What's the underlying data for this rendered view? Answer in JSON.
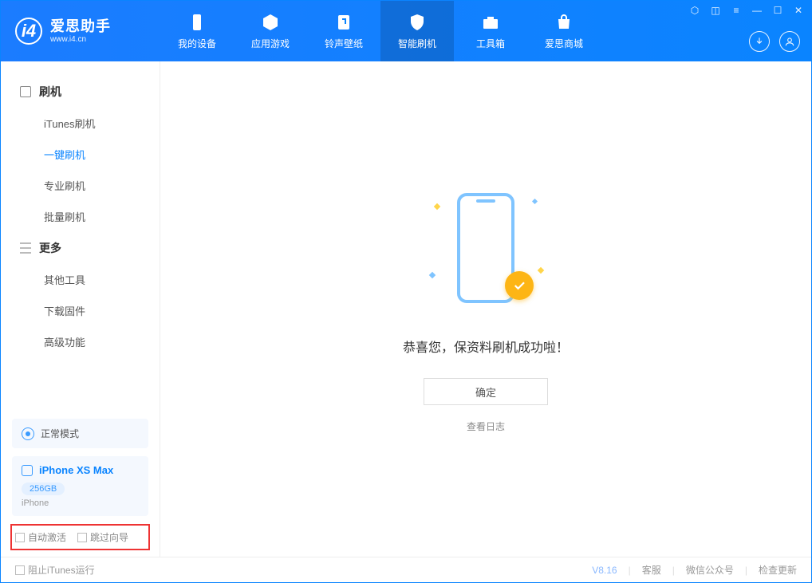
{
  "app": {
    "title": "爱思助手",
    "subtitle": "www.i4.cn"
  },
  "tabs": [
    {
      "label": "我的设备"
    },
    {
      "label": "应用游戏"
    },
    {
      "label": "铃声壁纸"
    },
    {
      "label": "智能刷机"
    },
    {
      "label": "工具箱"
    },
    {
      "label": "爱思商城"
    }
  ],
  "sidebar": {
    "group1": {
      "title": "刷机",
      "items": [
        "iTunes刷机",
        "一键刷机",
        "专业刷机",
        "批量刷机"
      ]
    },
    "group2": {
      "title": "更多",
      "items": [
        "其他工具",
        "下载固件",
        "高级功能"
      ]
    }
  },
  "mode_box": {
    "label": "正常模式"
  },
  "device": {
    "name": "iPhone XS Max",
    "capacity": "256GB",
    "type": "iPhone"
  },
  "highlight": {
    "opt1": "自动激活",
    "opt2": "跳过向导"
  },
  "main": {
    "message": "恭喜您，保资料刷机成功啦！",
    "ok": "确定",
    "log": "查看日志"
  },
  "footer": {
    "block_itunes": "阻止iTunes运行",
    "version": "V8.16",
    "links": [
      "客服",
      "微信公众号",
      "检查更新"
    ]
  }
}
